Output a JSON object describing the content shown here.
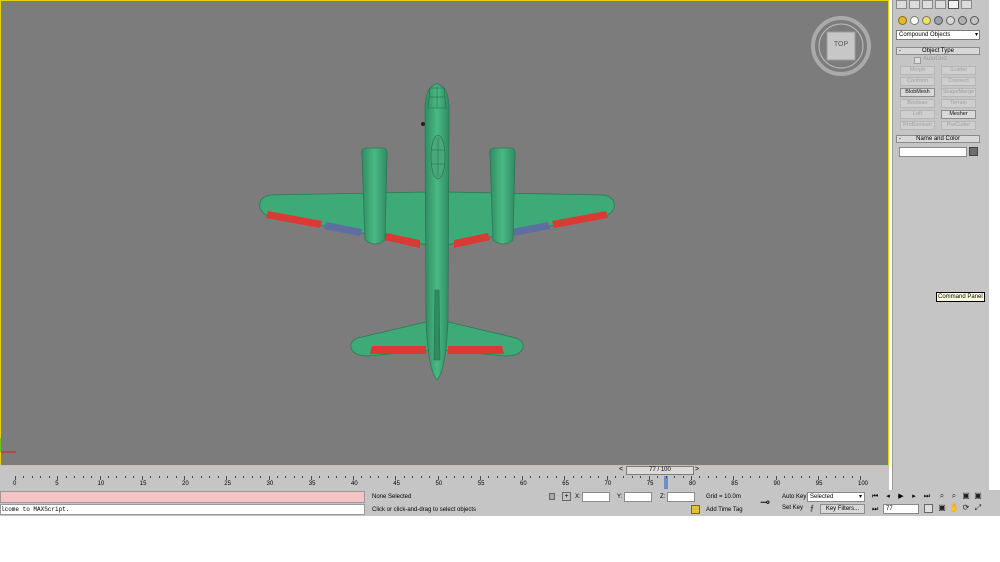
{
  "viewport": {
    "label": "TOP"
  },
  "command_panel": {
    "tooltip": "Command Panel",
    "category_dropdown": "Compound Objects",
    "object_type_title": "Object Type",
    "autogrid_label": "AutoGrid",
    "buttons": [
      "Morph",
      "Scatter",
      "Conform",
      "Connect",
      "BlobMesh",
      "ShapeMerge",
      "Boolean",
      "Terrain",
      "Loft",
      "Mesher",
      "ProBoolean",
      "ProCutter"
    ],
    "name_color_title": "Name and Color",
    "name_value": "",
    "minus": "-"
  },
  "timeline": {
    "slider_text": "77 / 100",
    "prev": "<",
    "next": ">",
    "ticks": [
      "0",
      "5",
      "10",
      "15",
      "20",
      "25",
      "30",
      "35",
      "40",
      "45",
      "50",
      "55",
      "60",
      "65",
      "70",
      "75",
      "80",
      "85",
      "90",
      "95",
      "100"
    ]
  },
  "status": {
    "maxscript": "lcome to MAXScript.",
    "selection": "None Selected",
    "prompt": "Click or click-and-drag to select objects",
    "x_label": "X:",
    "y_label": "Y:",
    "z_label": "Z:",
    "grid": "Grid = 10.0m",
    "add_time_tag": "Add Time Tag",
    "auto_key": "Auto Key",
    "set_key": "Set Key",
    "key_mode": "Selected",
    "key_filters": "Key Filters...",
    "frame": "77"
  },
  "colors": {
    "viewport_bg": "#7c7c7c",
    "airframe": "#3daa78",
    "stripe_red": "#d93a34",
    "stripe_blue": "#5f6ea0",
    "active_border": "#e6d200"
  }
}
